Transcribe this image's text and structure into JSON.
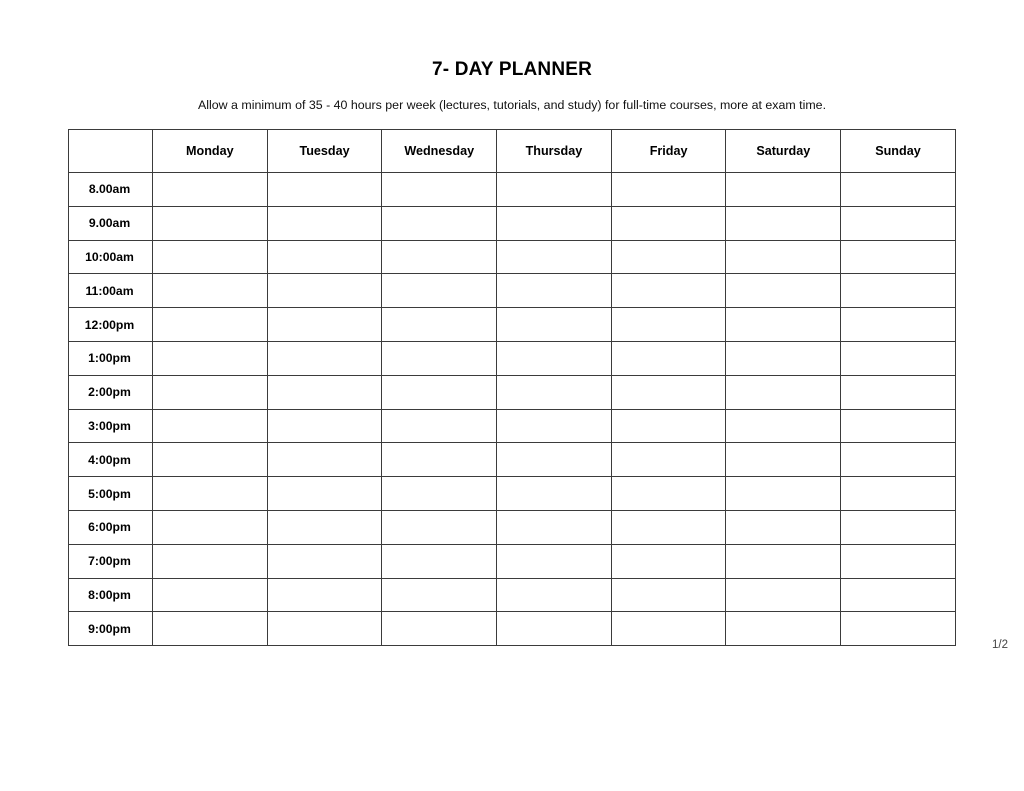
{
  "document": {
    "title": "7- DAY PLANNER",
    "subtitle": "Allow a minimum of 35 - 40 hours per week (lectures, tutorials, and study) for full-time courses, more at exam time.",
    "page_number": "1/2"
  },
  "table": {
    "corner_header": "",
    "day_headers": [
      "Monday",
      "Tuesday",
      "Wednesday",
      "Thursday",
      "Friday",
      "Saturday",
      "Sunday"
    ],
    "time_rows": [
      "8.00am",
      "9.00am",
      "10:00am",
      "11:00am",
      "12:00pm",
      "1:00pm",
      "2:00pm",
      "3:00pm",
      "4:00pm",
      "5:00pm",
      "6:00pm",
      "7:00pm",
      "8:00pm",
      "9:00pm"
    ],
    "cells": [
      [
        "",
        "",
        "",
        "",
        "",
        "",
        ""
      ],
      [
        "",
        "",
        "",
        "",
        "",
        "",
        ""
      ],
      [
        "",
        "",
        "",
        "",
        "",
        "",
        ""
      ],
      [
        "",
        "",
        "",
        "",
        "",
        "",
        ""
      ],
      [
        "",
        "",
        "",
        "",
        "",
        "",
        ""
      ],
      [
        "",
        "",
        "",
        "",
        "",
        "",
        ""
      ],
      [
        "",
        "",
        "",
        "",
        "",
        "",
        ""
      ],
      [
        "",
        "",
        "",
        "",
        "",
        "",
        ""
      ],
      [
        "",
        "",
        "",
        "",
        "",
        "",
        ""
      ],
      [
        "",
        "",
        "",
        "",
        "",
        "",
        ""
      ],
      [
        "",
        "",
        "",
        "",
        "",
        "",
        ""
      ],
      [
        "",
        "",
        "",
        "",
        "",
        "",
        ""
      ],
      [
        "",
        "",
        "",
        "",
        "",
        "",
        ""
      ],
      [
        "",
        "",
        "",
        "",
        "",
        "",
        ""
      ]
    ]
  },
  "colors": {
    "border": "#3b3b3b",
    "text": "#000000",
    "background": "#ffffff"
  }
}
